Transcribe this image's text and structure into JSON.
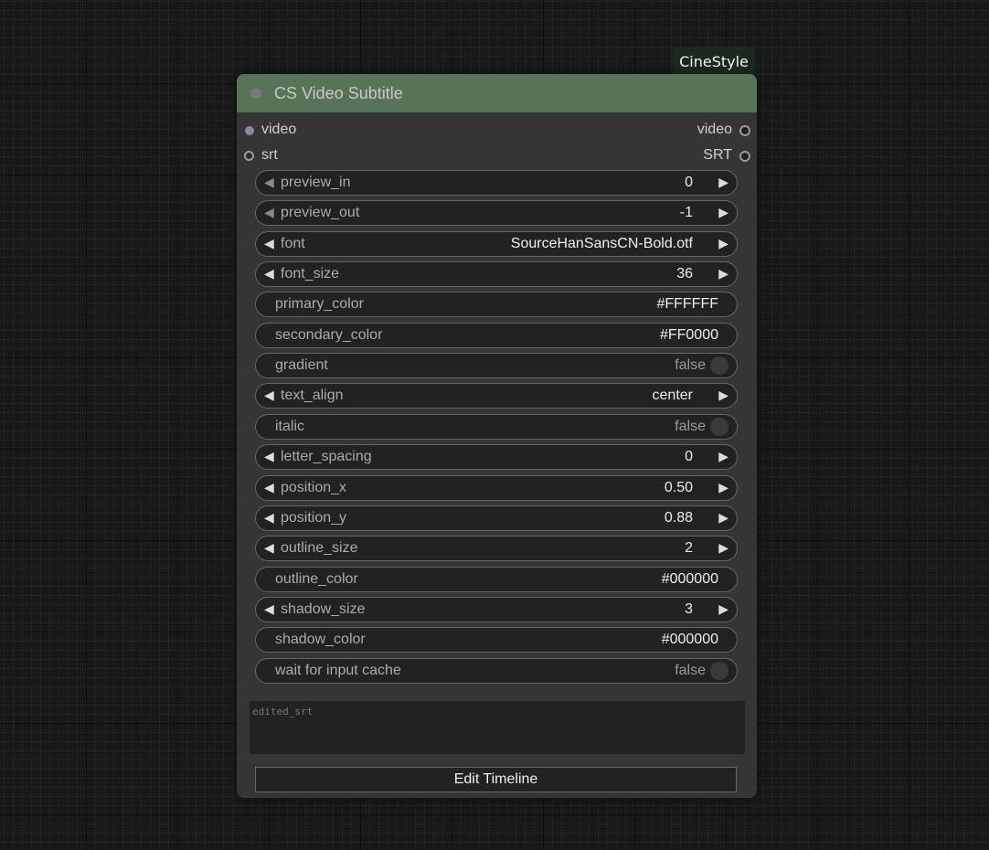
{
  "badge": "CineStyle",
  "node": {
    "title": "CS Video Subtitle",
    "inputs": [
      {
        "label": "video",
        "output": "video"
      },
      {
        "label": "srt",
        "output": "SRT"
      }
    ],
    "widgets": [
      {
        "label": "preview_in",
        "value": "0",
        "type": "number",
        "left_dim": true
      },
      {
        "label": "preview_out",
        "value": "-1",
        "type": "number",
        "left_dim": true
      },
      {
        "label": "font",
        "value": "SourceHanSansCN-Bold.otf",
        "type": "combo"
      },
      {
        "label": "font_size",
        "value": "36",
        "type": "number"
      },
      {
        "label": "primary_color",
        "value": "#FFFFFF",
        "type": "text"
      },
      {
        "label": "secondary_color",
        "value": "#FF0000",
        "type": "text"
      },
      {
        "label": "gradient",
        "value": "false",
        "type": "toggle"
      },
      {
        "label": "text_align",
        "value": "center",
        "type": "combo"
      },
      {
        "label": "italic",
        "value": "false",
        "type": "toggle"
      },
      {
        "label": "letter_spacing",
        "value": "0",
        "type": "number"
      },
      {
        "label": "position_x",
        "value": "0.50",
        "type": "number"
      },
      {
        "label": "position_y",
        "value": "0.88",
        "type": "number"
      },
      {
        "label": "outline_size",
        "value": "2",
        "type": "number"
      },
      {
        "label": "outline_color",
        "value": "#000000",
        "type": "text"
      },
      {
        "label": "shadow_size",
        "value": "3",
        "type": "number"
      },
      {
        "label": "shadow_color",
        "value": "#000000",
        "type": "text"
      },
      {
        "label": "wait for input cache",
        "value": "false",
        "type": "toggle"
      }
    ],
    "textarea_placeholder": "edited_srt",
    "button": "Edit Timeline"
  },
  "colors": {
    "title_bar": "#567556",
    "node_body": "#353535",
    "widget_bg": "#222222",
    "badge_bg": "#1b2a1f"
  }
}
